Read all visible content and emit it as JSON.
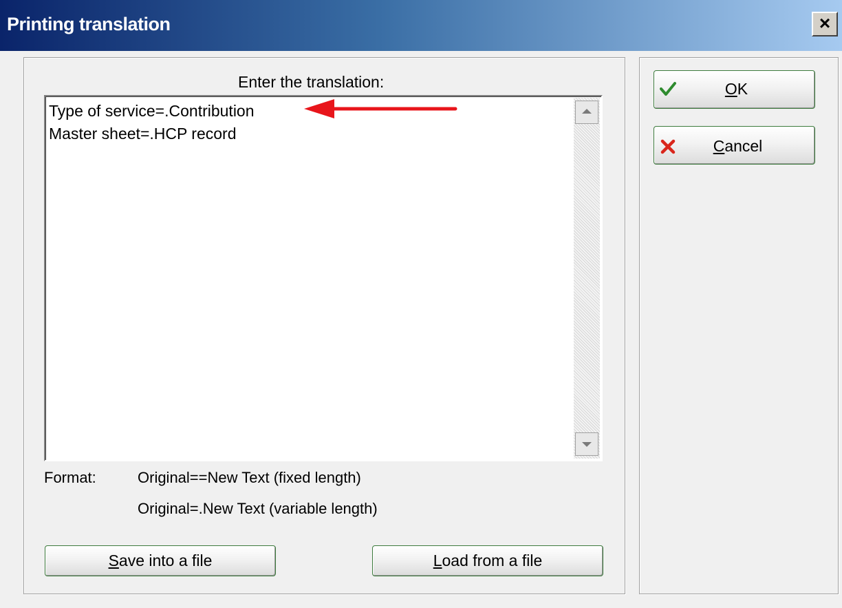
{
  "window": {
    "title": "Printing translation",
    "close_glyph": "×"
  },
  "translation": {
    "prompt": "Enter the translation:",
    "lines": [
      "Type of service=.Contribution",
      "Master sheet=.HCP record"
    ]
  },
  "format": {
    "label": "Format:",
    "line1": "Original==New Text  (fixed length)",
    "line2": "Original=.New Text  (variable length)"
  },
  "buttons": {
    "save": {
      "mnemonic": "S",
      "rest": "ave into a file"
    },
    "load": {
      "mnemonic": "L",
      "rest": "oad from a file"
    },
    "ok": {
      "mnemonic": "O",
      "rest": "K",
      "icon": "checkmark-icon"
    },
    "cancel": {
      "mnemonic": "C",
      "rest": "ancel",
      "icon": "x-mark-icon"
    }
  },
  "annotation": {
    "icon": "red-arrow-icon",
    "color": "#e8151b"
  },
  "colors": {
    "title_gradient_start": "#0a246a",
    "title_gradient_end": "#a6caf0",
    "button_border": "#3c7a3c",
    "ok_check": "#2e8b2e",
    "cancel_x": "#d9261c"
  }
}
